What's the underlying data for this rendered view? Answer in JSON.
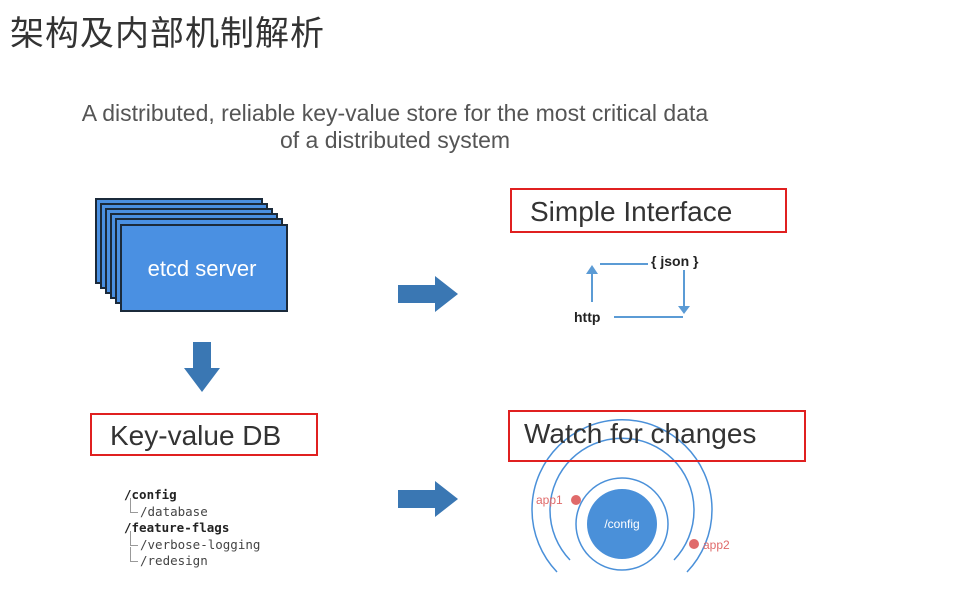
{
  "title": "架构及内部机制解析",
  "subtitle_line1": "A distributed, reliable key-value store for the most critical data",
  "subtitle_line2": "of a distributed system",
  "server": {
    "label": "etcd server"
  },
  "simple_interface": {
    "label": "Simple Interface",
    "json_label": "{ json }",
    "http_label": "http"
  },
  "keyvalue": {
    "label": "Key-value DB",
    "tree": [
      "/config",
      "/database",
      "/feature-flags",
      "/verbose-logging",
      "/redesign"
    ]
  },
  "watch": {
    "label": "Watch for changes",
    "center_label": "/config",
    "app1_label": "app1",
    "app2_label": "app2"
  },
  "colors": {
    "server_fill": "#4a90e2",
    "arrow": "#3a77b3",
    "highlight_border": "#e02020",
    "ring": "#4a90d9",
    "app_dot": "#e06a6a"
  }
}
